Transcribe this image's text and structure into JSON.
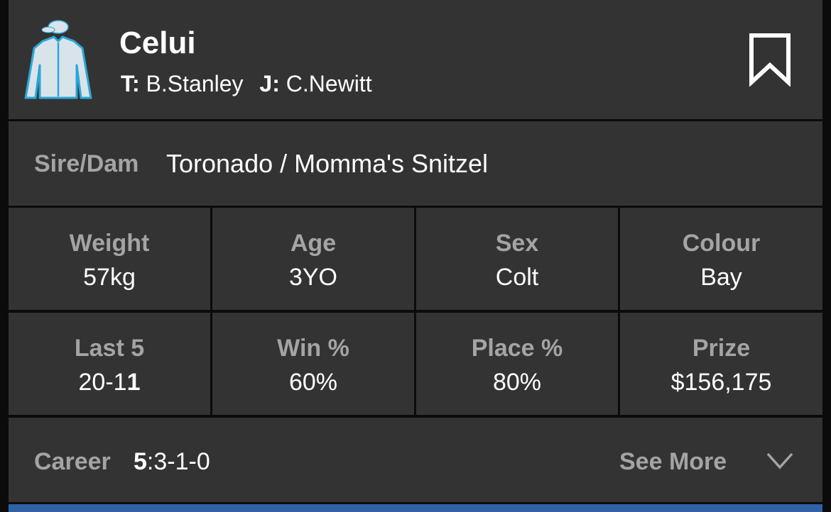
{
  "header": {
    "horse_name": "Celui",
    "trainer_label": "T:",
    "trainer_name": "B.Stanley",
    "jockey_label": "J:",
    "jockey_name": "C.Newitt",
    "silks_icon": "jockey-silks-icon",
    "bookmark_icon": "bookmark-icon"
  },
  "pedigree": {
    "label": "Sire/Dam",
    "value": "Toronado / Momma's Snitzel"
  },
  "stats": [
    {
      "label": "Weight",
      "value": "57kg"
    },
    {
      "label": "Age",
      "value": "3YO"
    },
    {
      "label": "Sex",
      "value": "Colt"
    },
    {
      "label": "Colour",
      "value": "Bay"
    },
    {
      "label": "Last 5",
      "value_pre": "20-1",
      "value_bold": "1"
    },
    {
      "label": "Win %",
      "value": "60%"
    },
    {
      "label": "Place %",
      "value": "80%"
    },
    {
      "label": "Prize",
      "value": "$156,175"
    }
  ],
  "career": {
    "label": "Career",
    "starts": "5",
    "record": ":3-1-0",
    "see_more_label": "See More",
    "chevron_icon": "chevron-down-icon"
  },
  "colors": {
    "panel": "#333333",
    "divider": "#0b0b0b",
    "label_grey": "#a4a4a4",
    "text": "#ffffff",
    "accent_bar": "#2f62a4",
    "silks_body": "#d9e3ea",
    "silks_trim": "#2aa7d6"
  }
}
